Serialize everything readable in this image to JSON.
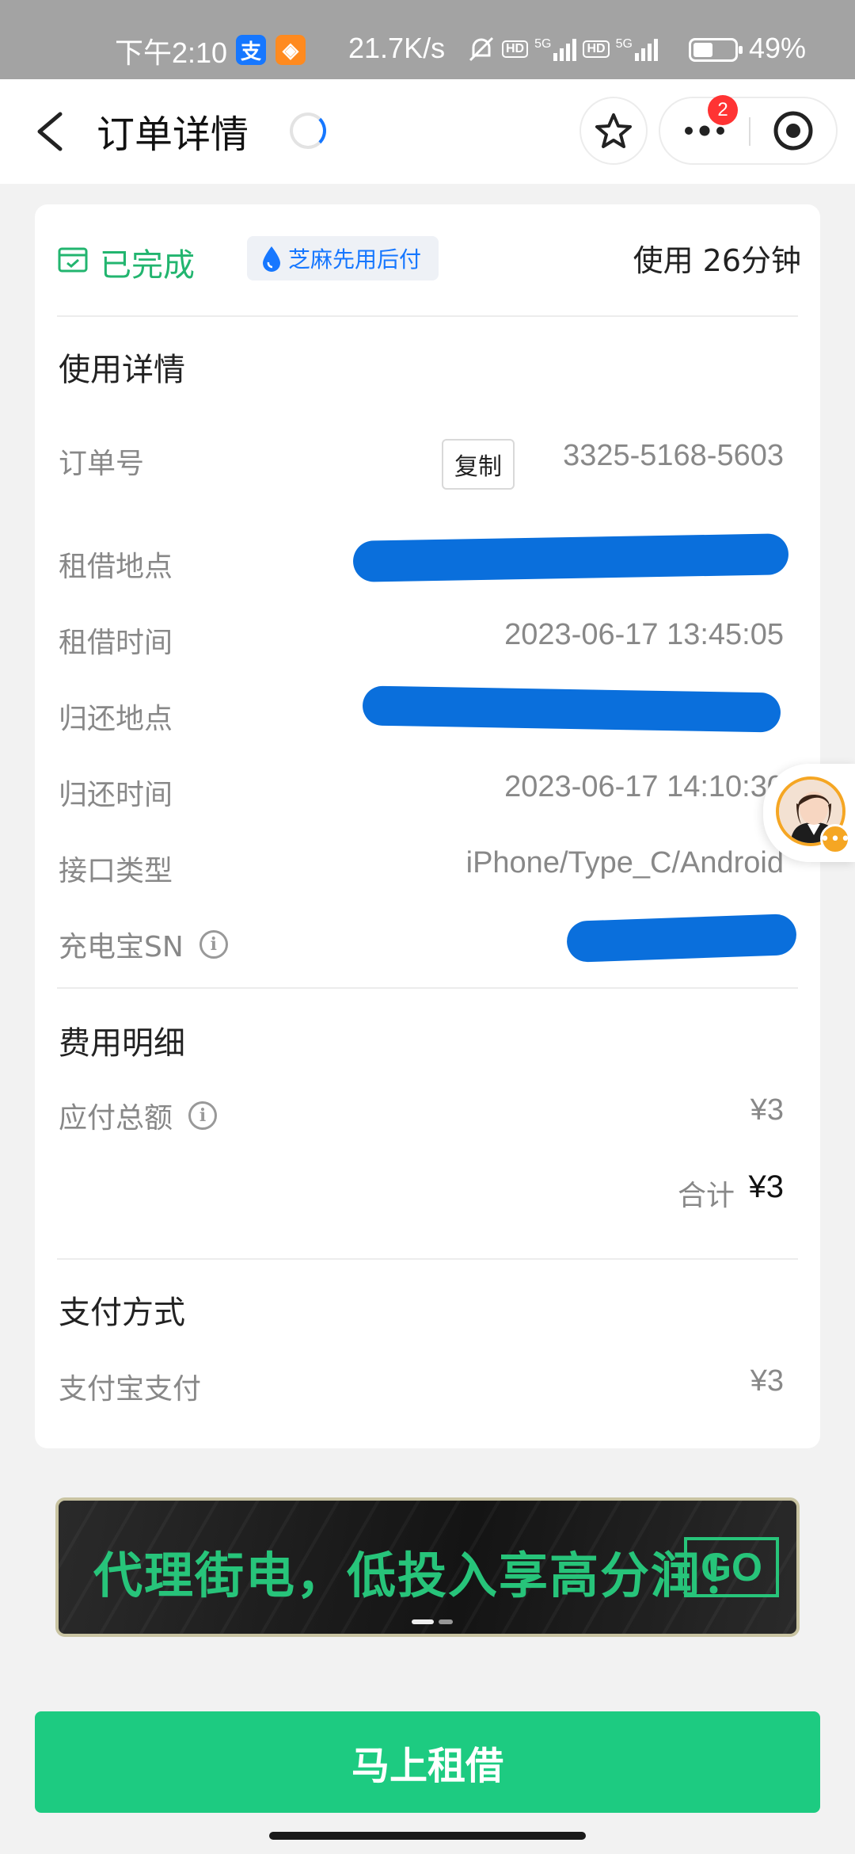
{
  "status_bar": {
    "time": "下午2:10",
    "net_speed": "21.7K/s",
    "battery": "49%",
    "icons": [
      "alipay-app-icon",
      "app-notification-icon",
      "mute-icon",
      "hd-icon",
      "5g-signal-icon",
      "battery-icon"
    ]
  },
  "header": {
    "back_icon": "chevron-left-icon",
    "title": "订单详情",
    "notification_count": "2",
    "favorite_icon": "star-icon",
    "more_icon": "more-dots-icon",
    "close_icon": "target-icon"
  },
  "order": {
    "status": "已完成",
    "zhima_tag": "芝麻先用后付",
    "usage": "使用 26分钟",
    "detail_section_title": "使用详情",
    "rows": [
      {
        "label": "订单号",
        "value": "3325-5168-5603",
        "action": "复制"
      },
      {
        "label": "租借地点",
        "value": ""
      },
      {
        "label": "租借时间",
        "value": "2023-06-17 13:45:05"
      },
      {
        "label": "归还地点",
        "value": ""
      },
      {
        "label": "归还时间",
        "value": "2023-06-17 14:10:30"
      },
      {
        "label": "接口类型",
        "value": "iPhone/Type_C/Android"
      },
      {
        "label": "充电宝SN",
        "value": ""
      }
    ]
  },
  "fees": {
    "section_title": "费用明细",
    "total_due_label": "应付总额",
    "total_due_value": "¥3",
    "sum_label": "合计",
    "sum_value": "¥3"
  },
  "payment": {
    "section_title": "支付方式",
    "method_label": "支付宝支付",
    "method_value": "¥3"
  },
  "banner": {
    "text": "代理街电，低投入享高分润！",
    "go": "GO"
  },
  "rent_button": "马上租借",
  "colors": {
    "accent_green": "#1dcb81",
    "status_green": "#22b56f",
    "alipay_blue": "#1677ff",
    "badge_red": "#ff3333",
    "redaction_blue": "#0a6fdc"
  }
}
